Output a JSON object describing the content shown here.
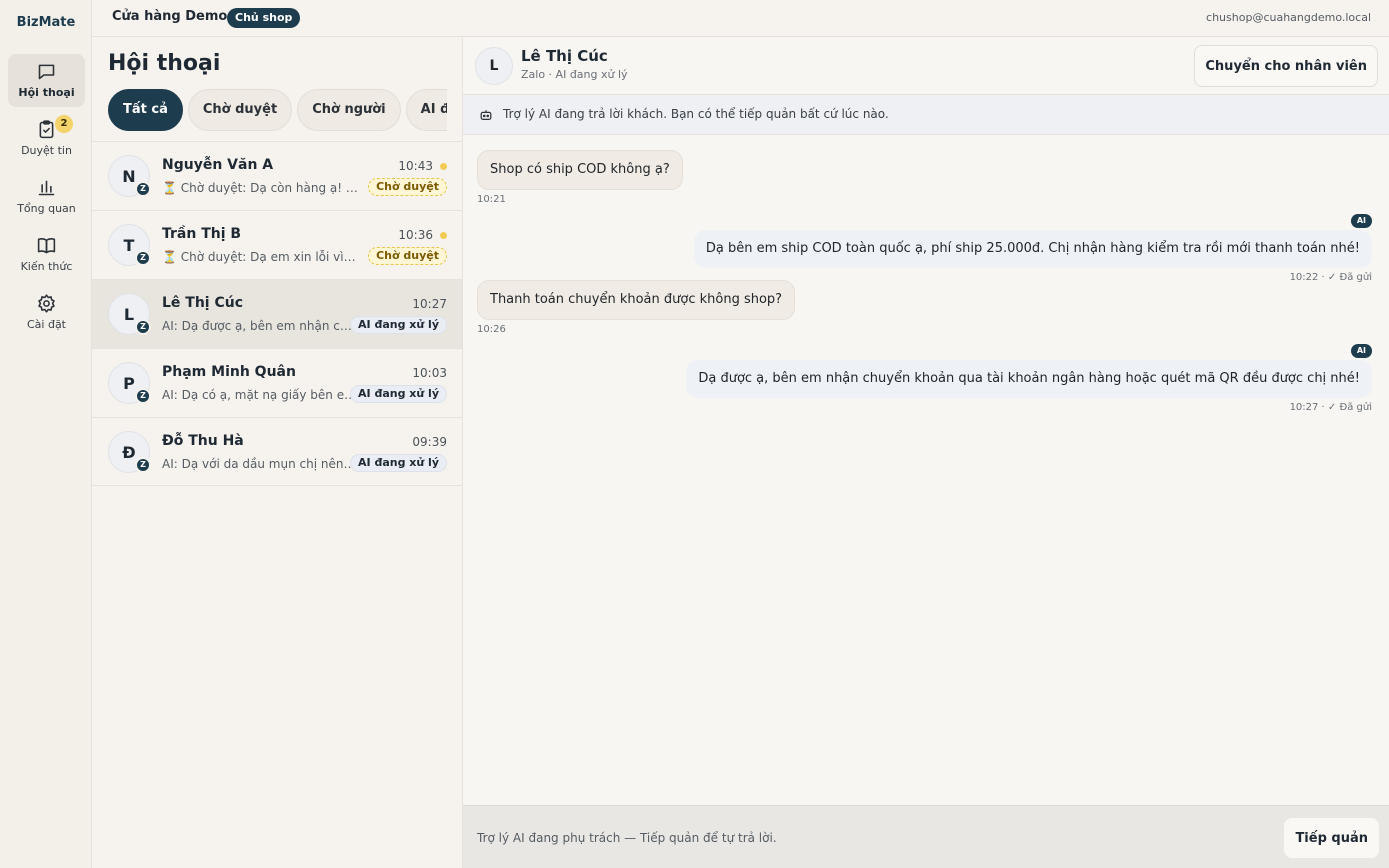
{
  "app": {
    "brand": "BizMate",
    "shop_name": "Cửa hàng Demo",
    "role": "Chủ shop",
    "user_email": "chushop@cuahangdemo.local"
  },
  "nav": {
    "items": [
      {
        "label": "Hội thoại",
        "icon": "chat-icon",
        "active": true
      },
      {
        "label": "Duyệt tin",
        "icon": "clipboard-check-icon",
        "badge": "2"
      },
      {
        "label": "Tổng quan",
        "icon": "bar-chart-icon"
      },
      {
        "label": "Kiến thức",
        "icon": "book-icon"
      },
      {
        "label": "Cài đặt",
        "icon": "gear-icon"
      }
    ]
  },
  "list": {
    "title": "Hội thoại",
    "filters": [
      "Tất cả",
      "Chờ duyệt",
      "Chờ người",
      "AI đang xử lý"
    ],
    "conversations": [
      {
        "initial": "N",
        "channel": "Z",
        "name": "Nguyễn Văn A",
        "time": "10:43",
        "preview": "⏳ Chờ duyệt: Dạ còn hàng ạ! Shop còn size M",
        "status": "Chờ duyệt"
      },
      {
        "initial": "T",
        "channel": "Z",
        "name": "Trần Thị B",
        "time": "10:36",
        "preview": "⏳ Chờ duyệt: Dạ em xin lỗi vì trải nghiệm chưa tốt",
        "status": "Chờ duyệt"
      },
      {
        "initial": "L",
        "channel": "Z",
        "name": "Lê Thị Cúc",
        "time": "10:27",
        "preview": "AI: Dạ được ạ, bên em nhận chuyển khoản",
        "status": "AI đang xử lý"
      },
      {
        "initial": "P",
        "channel": "Z",
        "name": "Phạm Minh Quân",
        "time": "10:03",
        "preview": "AI: Dạ có ạ, mặt nạ giấy bên em có bán",
        "status": "AI đang xử lý"
      },
      {
        "initial": "Đ",
        "channel": "Z",
        "name": "Đỗ Thu Hà",
        "time": "09:39",
        "preview": "AI: Dạ với da dầu mụn chị nên dùng",
        "status": "AI đang xử lý"
      }
    ]
  },
  "chat": {
    "initial": "L",
    "name": "Lê Thị Cúc",
    "subtitle": "Zalo · AI đang xử lý",
    "handoff_label": "Chuyển cho nhân viên",
    "banner": "Trợ lý AI đang trả lời khách. Bạn có thể tiếp quản bất cứ lúc nào.",
    "ai_tag": "AI",
    "messages": [
      {
        "text": "Shop có ship COD không ạ?",
        "meta": "10:21"
      },
      {
        "text": "Dạ bên em ship COD toàn quốc ạ, phí ship 25.000đ. Chị nhận hàng kiểm tra rồi mới thanh toán nhé!",
        "meta": "10:22 · ✓ Đã gửi"
      },
      {
        "text": "Thanh toán chuyển khoản được không shop?",
        "meta": "10:26"
      },
      {
        "text": "Dạ được ạ, bên em nhận chuyển khoản qua tài khoản ngân hàng hoặc quét mã QR đều được chị nhé!",
        "meta": "10:27 · ✓ Đã gửi"
      }
    ],
    "composer_text": "Trợ lý AI đang phụ trách — Tiếp quản để tự trả lời.",
    "takeover_label": "Tiếp quản"
  }
}
